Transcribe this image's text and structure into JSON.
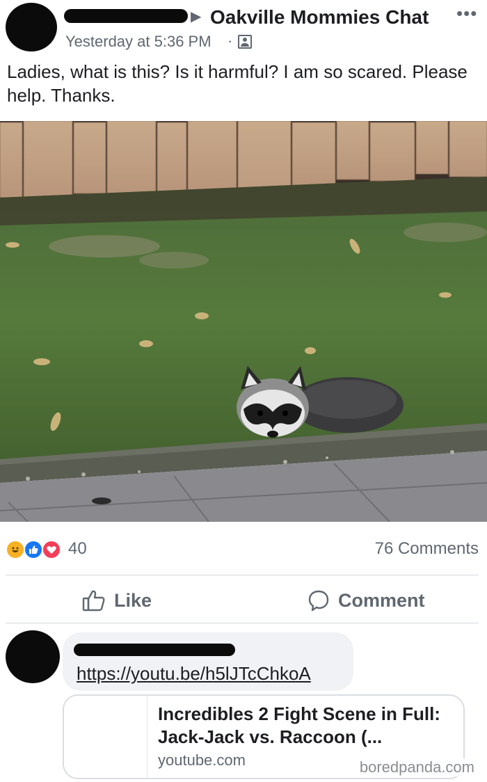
{
  "post": {
    "group_name": "Oakville Mommies Chat",
    "timestamp": "Yesterday at 5:36 PM",
    "separator": "·",
    "text": "Ladies, what is this? Is it harmful? I am so scared. Please help. Thanks.",
    "more_glyph": "•••",
    "arrow_glyph": "▶"
  },
  "reactions": {
    "count": "40",
    "comments_count": "76 Comments",
    "icons": [
      "haha-reaction-icon",
      "like-reaction-icon",
      "love-reaction-icon"
    ]
  },
  "actions": {
    "like_label": "Like",
    "comment_label": "Comment"
  },
  "comment": {
    "link_text": "https://youtu.be/h5lJTcChkoA",
    "preview_title": "Incredibles 2 Fight Scene in Full: Jack-Jack vs. Raccoon (...",
    "preview_domain": "youtube.com"
  },
  "watermark": "boredpanda.com",
  "colors": {
    "secondary_text": "#606770",
    "like_blue": "#1877f2",
    "love_red": "#f33e58",
    "haha_yellow": "#f7b125",
    "bubble_bg": "#f0f2f5"
  }
}
